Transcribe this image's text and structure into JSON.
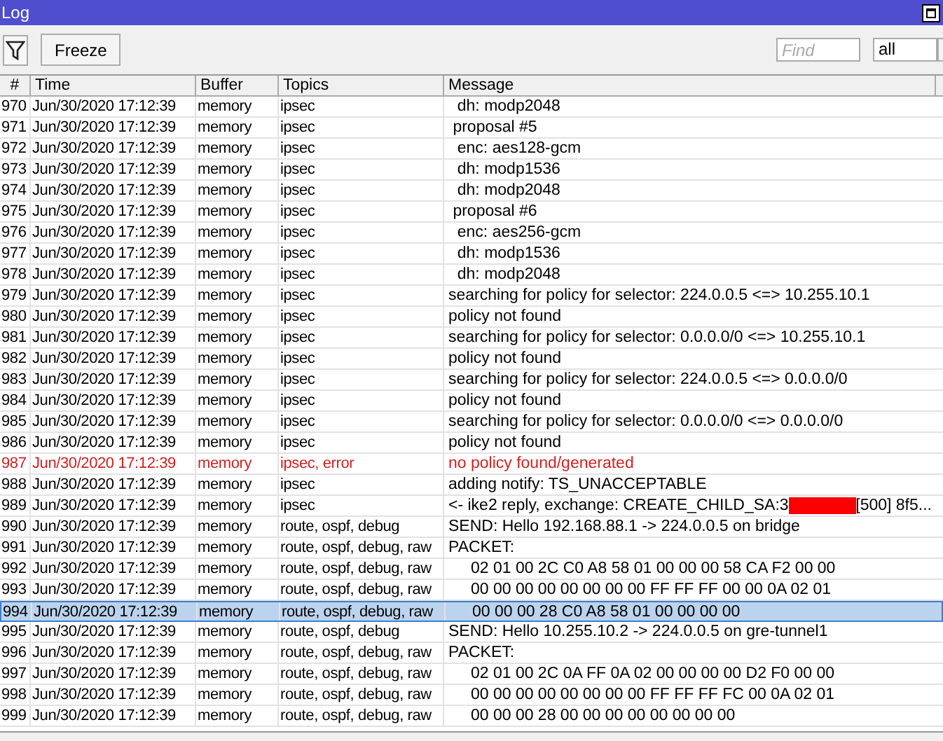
{
  "window": {
    "title": "Log"
  },
  "toolbar": {
    "freeze_button": "Freeze",
    "find": {
      "placeholder": "Find"
    },
    "filter_select": "all"
  },
  "table": {
    "columns": [
      "#",
      "Time",
      "Buffer",
      "Topics",
      "Message"
    ],
    "rows": [
      {
        "num": "970",
        "time": "Jun/30/2020 17:12:39",
        "buffer": "memory",
        "topics": "ipsec",
        "message": "  dh: modp2048",
        "error": false,
        "selected": false
      },
      {
        "num": "971",
        "time": "Jun/30/2020 17:12:39",
        "buffer": "memory",
        "topics": "ipsec",
        "message": " proposal #5",
        "error": false,
        "selected": false
      },
      {
        "num": "972",
        "time": "Jun/30/2020 17:12:39",
        "buffer": "memory",
        "topics": "ipsec",
        "message": "  enc: aes128-gcm",
        "error": false,
        "selected": false
      },
      {
        "num": "973",
        "time": "Jun/30/2020 17:12:39",
        "buffer": "memory",
        "topics": "ipsec",
        "message": "  dh: modp1536",
        "error": false,
        "selected": false
      },
      {
        "num": "974",
        "time": "Jun/30/2020 17:12:39",
        "buffer": "memory",
        "topics": "ipsec",
        "message": "  dh: modp2048",
        "error": false,
        "selected": false
      },
      {
        "num": "975",
        "time": "Jun/30/2020 17:12:39",
        "buffer": "memory",
        "topics": "ipsec",
        "message": " proposal #6",
        "error": false,
        "selected": false
      },
      {
        "num": "976",
        "time": "Jun/30/2020 17:12:39",
        "buffer": "memory",
        "topics": "ipsec",
        "message": "  enc: aes256-gcm",
        "error": false,
        "selected": false
      },
      {
        "num": "977",
        "time": "Jun/30/2020 17:12:39",
        "buffer": "memory",
        "topics": "ipsec",
        "message": "  dh: modp1536",
        "error": false,
        "selected": false
      },
      {
        "num": "978",
        "time": "Jun/30/2020 17:12:39",
        "buffer": "memory",
        "topics": "ipsec",
        "message": "  dh: modp2048",
        "error": false,
        "selected": false
      },
      {
        "num": "979",
        "time": "Jun/30/2020 17:12:39",
        "buffer": "memory",
        "topics": "ipsec",
        "message": "searching for policy for selector: 224.0.0.5 <=> 10.255.10.1",
        "error": false,
        "selected": false
      },
      {
        "num": "980",
        "time": "Jun/30/2020 17:12:39",
        "buffer": "memory",
        "topics": "ipsec",
        "message": "policy not found",
        "error": false,
        "selected": false
      },
      {
        "num": "981",
        "time": "Jun/30/2020 17:12:39",
        "buffer": "memory",
        "topics": "ipsec",
        "message": "searching for policy for selector: 0.0.0.0/0 <=> 10.255.10.1",
        "error": false,
        "selected": false
      },
      {
        "num": "982",
        "time": "Jun/30/2020 17:12:39",
        "buffer": "memory",
        "topics": "ipsec",
        "message": "policy not found",
        "error": false,
        "selected": false
      },
      {
        "num": "983",
        "time": "Jun/30/2020 17:12:39",
        "buffer": "memory",
        "topics": "ipsec",
        "message": "searching for policy for selector: 224.0.0.5 <=> 0.0.0.0/0",
        "error": false,
        "selected": false
      },
      {
        "num": "984",
        "time": "Jun/30/2020 17:12:39",
        "buffer": "memory",
        "topics": "ipsec",
        "message": "policy not found",
        "error": false,
        "selected": false
      },
      {
        "num": "985",
        "time": "Jun/30/2020 17:12:39",
        "buffer": "memory",
        "topics": "ipsec",
        "message": "searching for policy for selector: 0.0.0.0/0 <=> 0.0.0.0/0",
        "error": false,
        "selected": false
      },
      {
        "num": "986",
        "time": "Jun/30/2020 17:12:39",
        "buffer": "memory",
        "topics": "ipsec",
        "message": "policy not found",
        "error": false,
        "selected": false
      },
      {
        "num": "987",
        "time": "Jun/30/2020 17:12:39",
        "buffer": "memory",
        "topics": "ipsec, error",
        "message": "no policy found/generated",
        "error": true,
        "selected": false
      },
      {
        "num": "988",
        "time": "Jun/30/2020 17:12:39",
        "buffer": "memory",
        "topics": "ipsec",
        "message": "adding notify: TS_UNACCEPTABLE",
        "error": false,
        "selected": false
      },
      {
        "num": "989",
        "time": "Jun/30/2020 17:12:39",
        "buffer": "memory",
        "topics": "ipsec",
        "message": "<- ike2 reply, exchange: CREATE_CHILD_SA:3",
        "message_tail": "[500] 8f5...",
        "redacted": true,
        "error": false,
        "selected": false
      },
      {
        "num": "990",
        "time": "Jun/30/2020 17:12:39",
        "buffer": "memory",
        "topics": "route, ospf, debug",
        "message": "SEND: Hello 192.168.88.1 -> 224.0.0.5 on bridge",
        "error": false,
        "selected": false
      },
      {
        "num": "991",
        "time": "Jun/30/2020 17:12:39",
        "buffer": "memory",
        "topics": "route, ospf, debug, raw",
        "message": "PACKET:",
        "error": false,
        "selected": false
      },
      {
        "num": "992",
        "time": "Jun/30/2020 17:12:39",
        "buffer": "memory",
        "topics": "route, ospf, debug, raw",
        "message": "     02 01 00 2C C0 A8 58 01 00 00 00 58 CA F2 00 00",
        "error": false,
        "selected": false
      },
      {
        "num": "993",
        "time": "Jun/30/2020 17:12:39",
        "buffer": "memory",
        "topics": "route, ospf, debug, raw",
        "message": "     00 00 00 00 00 00 00 00 FF FF FF 00 00 0A 02 01",
        "error": false,
        "selected": false
      },
      {
        "num": "994",
        "time": "Jun/30/2020 17:12:39",
        "buffer": "memory",
        "topics": "route, ospf, debug, raw",
        "message": "     00 00 00 28 C0 A8 58 01 00 00 00 00",
        "error": false,
        "selected": true
      },
      {
        "num": "995",
        "time": "Jun/30/2020 17:12:39",
        "buffer": "memory",
        "topics": "route, ospf, debug",
        "message": "SEND: Hello 10.255.10.2 -> 224.0.0.5 on gre-tunnel1",
        "error": false,
        "selected": false
      },
      {
        "num": "996",
        "time": "Jun/30/2020 17:12:39",
        "buffer": "memory",
        "topics": "route, ospf, debug, raw",
        "message": "PACKET:",
        "error": false,
        "selected": false
      },
      {
        "num": "997",
        "time": "Jun/30/2020 17:12:39",
        "buffer": "memory",
        "topics": "route, ospf, debug, raw",
        "message": "     02 01 00 2C 0A FF 0A 02 00 00 00 00 D2 F0 00 00",
        "error": false,
        "selected": false
      },
      {
        "num": "998",
        "time": "Jun/30/2020 17:12:39",
        "buffer": "memory",
        "topics": "route, ospf, debug, raw",
        "message": "     00 00 00 00 00 00 00 00 FF FF FF FC 00 0A 02 01",
        "error": false,
        "selected": false
      },
      {
        "num": "999",
        "time": "Jun/30/2020 17:12:39",
        "buffer": "memory",
        "topics": "route, ospf, debug, raw",
        "message": "     00 00 00 28 00 00 00 00 00 00 00 00",
        "error": false,
        "selected": false
      }
    ]
  }
}
